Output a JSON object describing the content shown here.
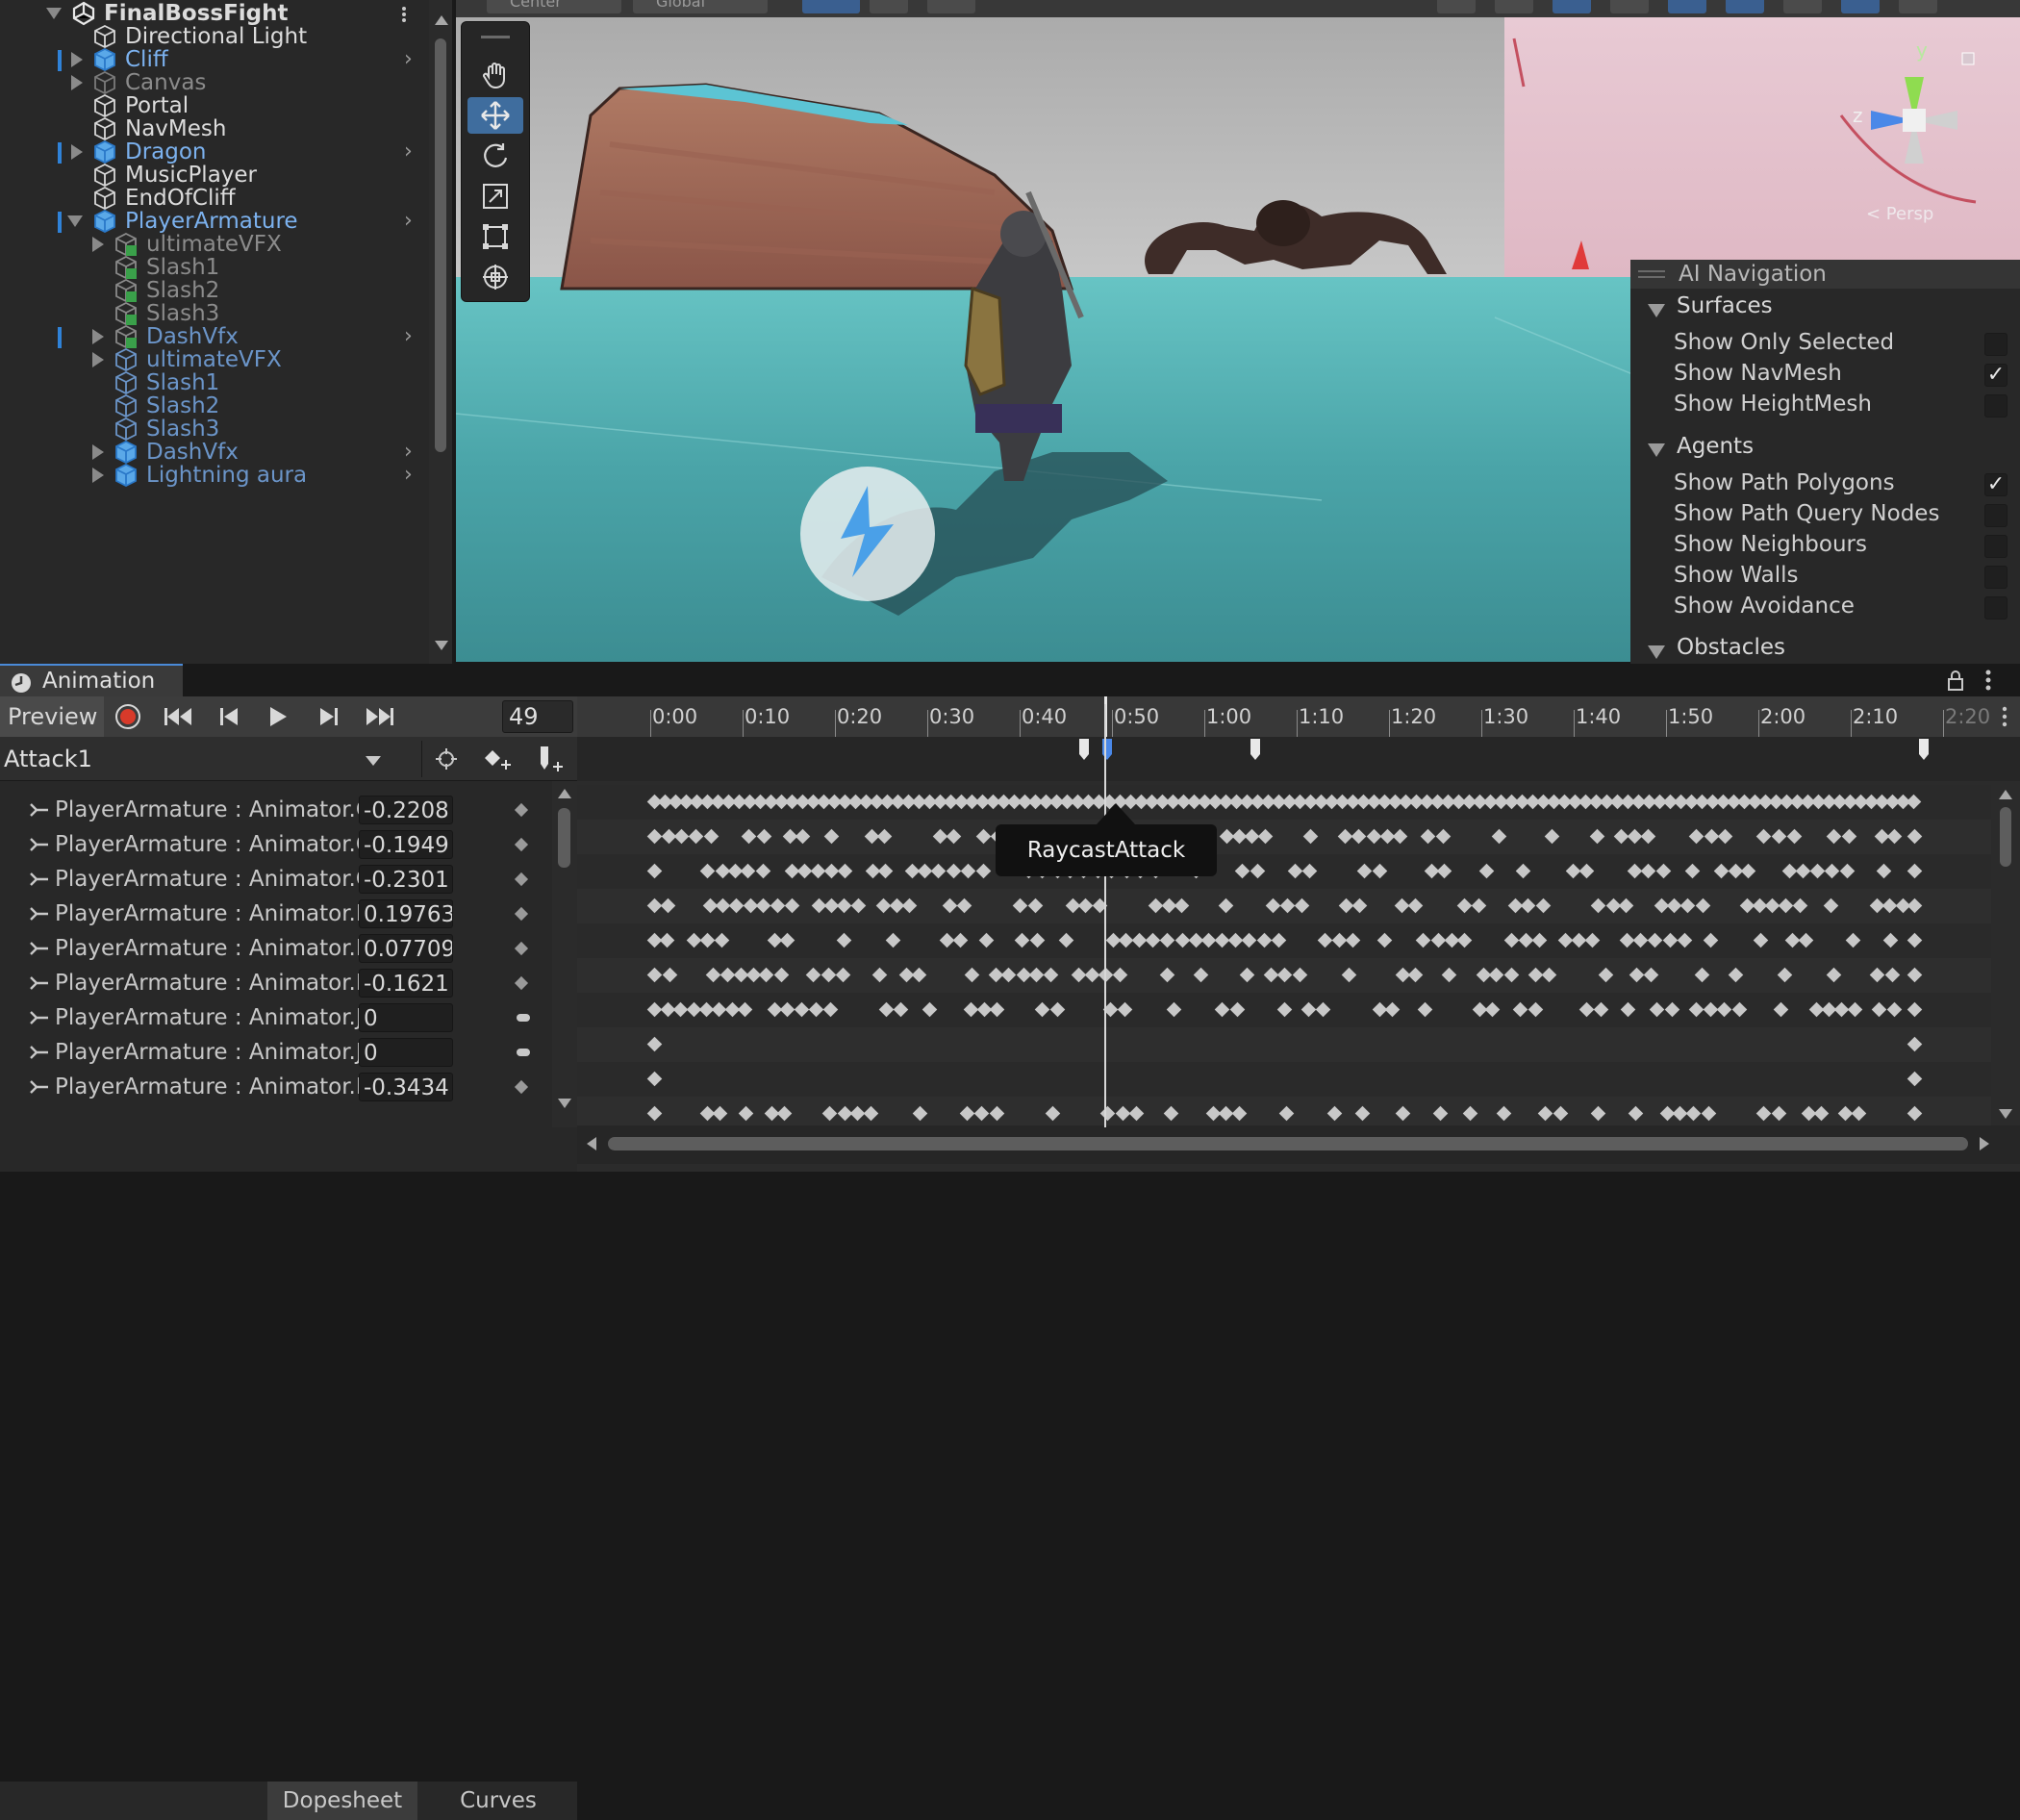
{
  "hierarchy": {
    "items": [
      {
        "label": "FinalBossFight",
        "depth": 0,
        "expand": "down",
        "color": "white",
        "icon": "unity-logo-icon",
        "bold": true,
        "menu": true
      },
      {
        "label": "Directional Light",
        "depth": 1,
        "expand": "none",
        "color": "white",
        "icon": "gameobject-icon"
      },
      {
        "label": "Cliff",
        "depth": 1,
        "expand": "right",
        "color": "blue",
        "icon": "prefab-icon",
        "chevron": true,
        "marked": true
      },
      {
        "label": "Canvas",
        "depth": 1,
        "expand": "right",
        "color": "grey",
        "icon": "gameobject-icon"
      },
      {
        "label": "Portal",
        "depth": 1,
        "expand": "none",
        "color": "white",
        "icon": "gameobject-icon"
      },
      {
        "label": "NavMesh",
        "depth": 1,
        "expand": "none",
        "color": "white",
        "icon": "gameobject-icon"
      },
      {
        "label": "Dragon",
        "depth": 1,
        "expand": "right",
        "color": "blue",
        "icon": "prefab-icon",
        "chevron": true,
        "marked": true
      },
      {
        "label": "MusicPlayer",
        "depth": 1,
        "expand": "none",
        "color": "white",
        "icon": "gameobject-icon"
      },
      {
        "label": "EndOfCliff",
        "depth": 1,
        "expand": "none",
        "color": "white",
        "icon": "gameobject-icon"
      },
      {
        "label": "PlayerArmature",
        "depth": 1,
        "expand": "down",
        "color": "blue",
        "icon": "prefab-icon",
        "chevron": true,
        "marked": true
      },
      {
        "label": "ultimateVFX",
        "depth": 2,
        "expand": "right",
        "color": "grey",
        "icon": "prefab-green-icon"
      },
      {
        "label": "Slash1",
        "depth": 2,
        "expand": "none",
        "color": "grey",
        "icon": "prefab-green-icon"
      },
      {
        "label": "Slash2",
        "depth": 2,
        "expand": "none",
        "color": "grey",
        "icon": "prefab-green-icon"
      },
      {
        "label": "Slash3",
        "depth": 2,
        "expand": "none",
        "color": "grey",
        "icon": "prefab-green-icon"
      },
      {
        "label": "DashVfx",
        "depth": 2,
        "expand": "right",
        "color": "dblue",
        "icon": "prefab-green-icon",
        "chevron": true,
        "marked": true
      },
      {
        "label": "ultimateVFX",
        "depth": 2,
        "expand": "right",
        "color": "dblue",
        "icon": "gameobject-icon"
      },
      {
        "label": "Slash1",
        "depth": 2,
        "expand": "none",
        "color": "dblue",
        "icon": "gameobject-icon"
      },
      {
        "label": "Slash2",
        "depth": 2,
        "expand": "none",
        "color": "dblue",
        "icon": "gameobject-icon"
      },
      {
        "label": "Slash3",
        "depth": 2,
        "expand": "none",
        "color": "dblue",
        "icon": "gameobject-icon"
      },
      {
        "label": "DashVfx",
        "depth": 2,
        "expand": "right",
        "color": "dblue",
        "icon": "prefab-icon",
        "chevron": true
      },
      {
        "label": "Lightning aura",
        "depth": 2,
        "expand": "right",
        "color": "dblue",
        "icon": "prefab-icon",
        "chevron": true
      }
    ]
  },
  "scene": {
    "topbar": {
      "center_label": "Center",
      "global_label": "Global"
    },
    "tools": [
      "hand-tool-icon",
      "move-tool-icon",
      "rotate-tool-icon",
      "scale-tool-icon",
      "rect-tool-icon",
      "transform-tool-icon"
    ],
    "active_tool": 1,
    "gizmo": {
      "y": "y",
      "z": "z",
      "persp": "< Persp"
    },
    "ai_navigation": {
      "title": "AI Navigation",
      "surfaces": {
        "label": "Surfaces",
        "items": [
          {
            "label": "Show Only Selected",
            "checked": false
          },
          {
            "label": "Show NavMesh",
            "checked": true
          },
          {
            "label": "Show HeightMesh",
            "checked": false
          }
        ]
      },
      "agents": {
        "label": "Agents",
        "items": [
          {
            "label": "Show Path Polygons",
            "checked": true
          },
          {
            "label": "Show Path Query Nodes",
            "checked": false
          },
          {
            "label": "Show Neighbours",
            "checked": false
          },
          {
            "label": "Show Walls",
            "checked": false
          },
          {
            "label": "Show Avoidance",
            "checked": false
          }
        ]
      },
      "obstacles": {
        "label": "Obstacles"
      }
    }
  },
  "animation": {
    "tab_label": "Animation",
    "preview_label": "Preview",
    "frame": "49",
    "clip": "Attack1",
    "ruler": [
      "0:00",
      "0:10",
      "0:20",
      "0:30",
      "0:40",
      "0:50",
      "1:00",
      "1:10",
      "1:20",
      "1:30",
      "1:40",
      "1:50",
      "2:00",
      "2:10",
      "2:20"
    ],
    "playhead_time": "0:49",
    "event_tooltip": "RaycastAttack",
    "properties": [
      {
        "label": "PlayerArmature : Animator.C",
        "value": "-0.2208"
      },
      {
        "label": "PlayerArmature : Animator.C",
        "value": "-0.1949"
      },
      {
        "label": "PlayerArmature : Animator.C",
        "value": "-0.2301"
      },
      {
        "label": "PlayerArmature : Animator.H",
        "value": "0.19763"
      },
      {
        "label": "PlayerArmature : Animator.H",
        "value": "0.07709"
      },
      {
        "label": "PlayerArmature : Animator.H",
        "value": "-0.1621"
      },
      {
        "label": "PlayerArmature : Animator.J",
        "value": "0",
        "flat": true
      },
      {
        "label": "PlayerArmature : Animator.J",
        "value": "0",
        "flat": true
      },
      {
        "label": "PlayerArmature : Animator.L",
        "value": "-0.3434"
      }
    ],
    "modes": {
      "dopesheet": "Dopesheet",
      "curves": "Curves"
    }
  },
  "colors": {
    "accent": "#2f82d8",
    "record": "#d83a2a",
    "panel": "#282828",
    "prefab_blue": "#7cb2ef"
  }
}
